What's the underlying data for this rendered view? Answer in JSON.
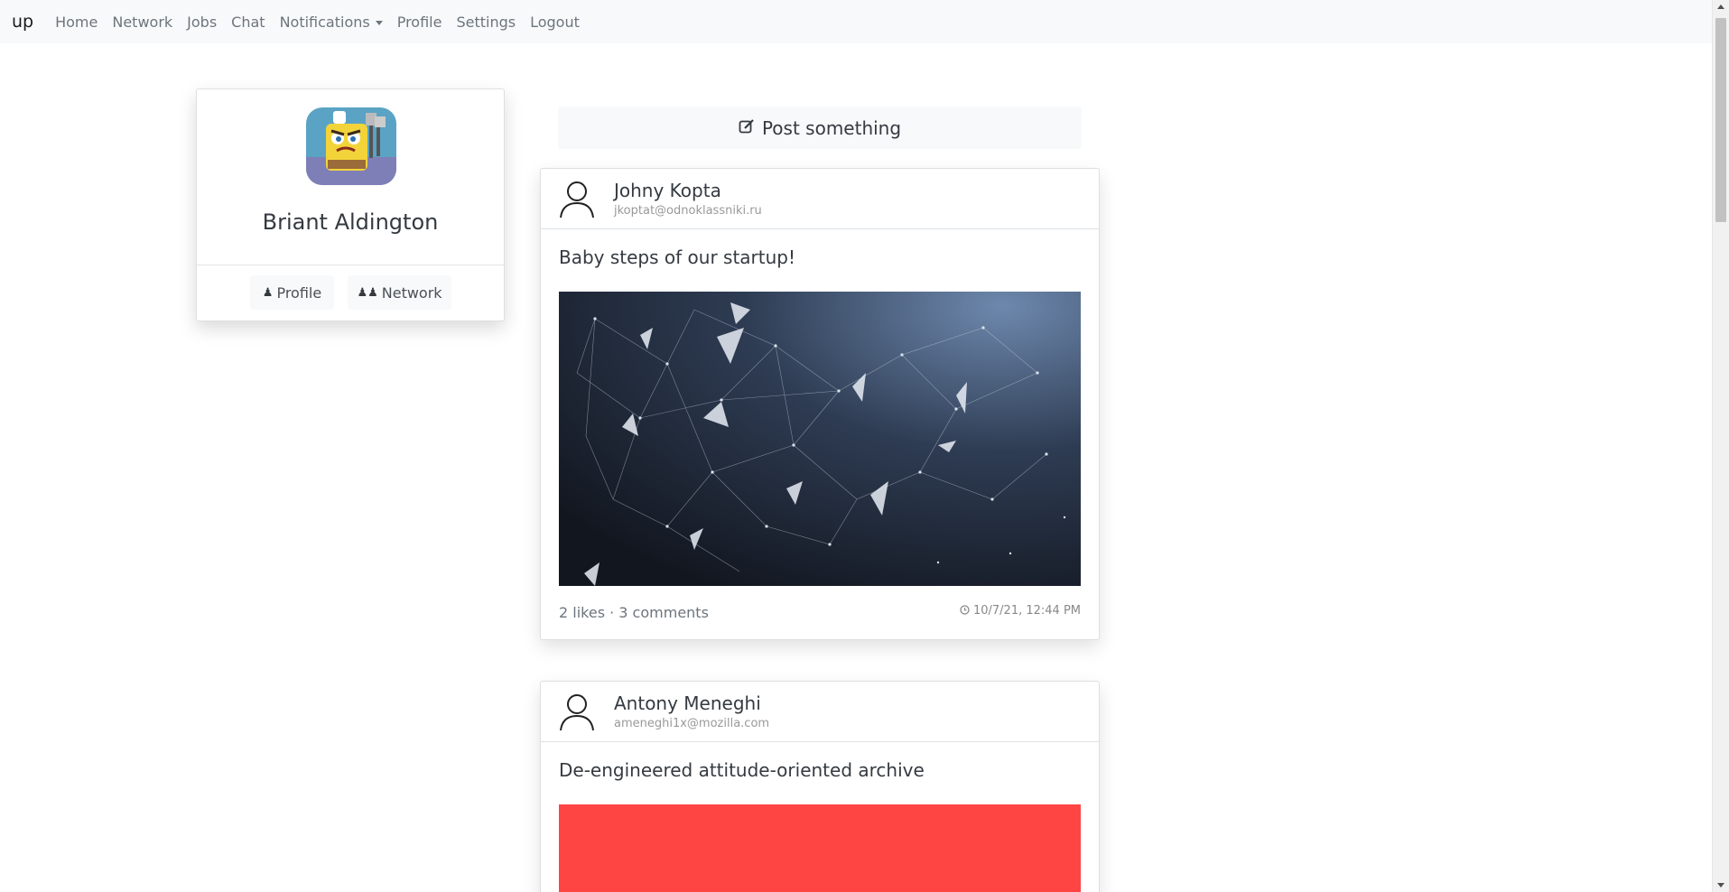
{
  "navbar": {
    "brand": "up",
    "links": [
      "Home",
      "Network",
      "Jobs",
      "Chat",
      "Notifications",
      "Profile",
      "Settings",
      "Logout"
    ]
  },
  "profile": {
    "name": "Briant Aldington",
    "profile_button": "Profile",
    "network_button": "Network"
  },
  "composer": {
    "label": "Post something"
  },
  "posts": [
    {
      "author": "Johny Kopta",
      "email": "jkoptat@odnoklassniki.ru",
      "text": "Baby steps of our startup!",
      "stats": "2 likes · 3 comments",
      "timestamp": "10/7/21, 12:44 PM",
      "image": "abstract-network-image"
    },
    {
      "author": "Antony Meneghi",
      "email": "ameneghi1x@mozilla.com",
      "text": "De-engineered attitude-oriented archive",
      "image": "red-placeholder-image",
      "image_color": "#ff4444"
    }
  ],
  "icons": {
    "user": "user-outline-icon",
    "edit": "edit-icon",
    "clock": "clock-icon",
    "profile": "user-icon",
    "network": "users-icon"
  }
}
